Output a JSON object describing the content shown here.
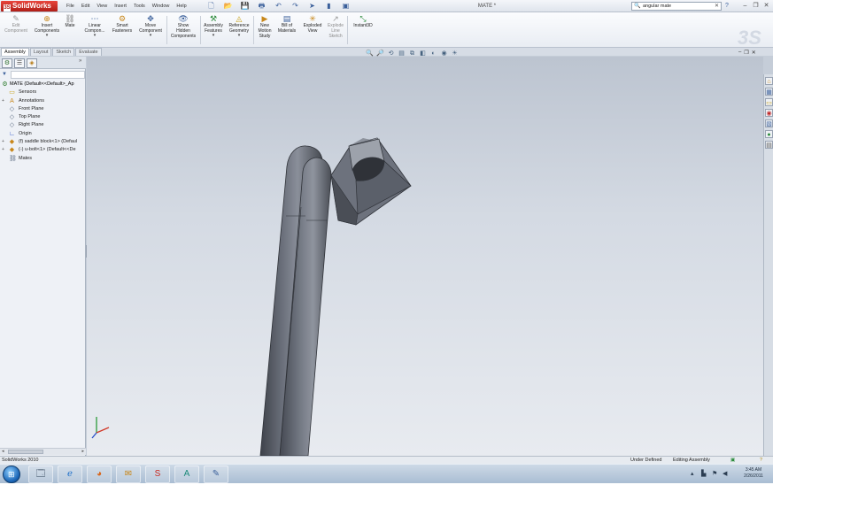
{
  "app": {
    "name": "SolidWorks",
    "document_title": "MATE *",
    "menus": [
      "File",
      "Edit",
      "View",
      "Insert",
      "Tools",
      "Window",
      "Help"
    ],
    "search": {
      "value": "angular mate"
    }
  },
  "quick_access": [
    {
      "icon": "new-document-icon",
      "glyph": "🗋"
    },
    {
      "icon": "open-folder-icon",
      "glyph": "📂"
    },
    {
      "icon": "save-icon",
      "glyph": "💾"
    },
    {
      "icon": "print-icon",
      "glyph": "🖶"
    },
    {
      "icon": "undo-icon",
      "glyph": "↶"
    },
    {
      "icon": "redo-icon",
      "glyph": "↷"
    },
    {
      "icon": "select-arrow-icon",
      "glyph": "➤"
    },
    {
      "icon": "rebuild-traffic-light-icon",
      "glyph": "▮"
    },
    {
      "icon": "options-icon",
      "glyph": "▣"
    }
  ],
  "command_manager": {
    "buttons": [
      {
        "label": "Edit\nComponent",
        "dim": true
      },
      {
        "label": "Insert\nComponents",
        "dropdown": true
      },
      {
        "label": "Mate"
      },
      {
        "label": "Linear\nCompon...",
        "dropdown": true
      },
      {
        "label": "Smart\nFasteners"
      },
      {
        "label": "Move\nComponent",
        "dropdown": true
      },
      {
        "label": "Show\nHidden\nComponents"
      },
      {
        "label": "Assembly\nFeatures",
        "dropdown": true
      },
      {
        "label": "Reference\nGeometry",
        "dropdown": true
      },
      {
        "label": "New\nMotion\nStudy"
      },
      {
        "label": "Bill of\nMaterials"
      },
      {
        "label": "Exploded\nView"
      },
      {
        "label": "Explode\nLine\nSketch",
        "dim": true
      },
      {
        "label": "Instant3D"
      }
    ],
    "tabs": [
      "Assembly",
      "Layout",
      "Sketch",
      "Evaluate"
    ],
    "active_tab": "Assembly"
  },
  "feature_tree": {
    "nodes": [
      {
        "label": "MATE  (Default<<Default>_Ap",
        "icon": "assembly-icon",
        "level": 0,
        "expander": ""
      },
      {
        "label": "Sensors",
        "icon": "sensor-folder-icon",
        "level": 1,
        "expander": ""
      },
      {
        "label": "Annotations",
        "icon": "annotations-icon",
        "level": 1,
        "expander": "+"
      },
      {
        "label": "Front Plane",
        "icon": "plane-icon",
        "level": 1,
        "expander": ""
      },
      {
        "label": "Top Plane",
        "icon": "plane-icon",
        "level": 1,
        "expander": ""
      },
      {
        "label": "Right Plane",
        "icon": "plane-icon",
        "level": 1,
        "expander": ""
      },
      {
        "label": "Origin",
        "icon": "origin-icon",
        "level": 1,
        "expander": ""
      },
      {
        "label": "(f) saddle block<1> (Defaul",
        "icon": "part-icon",
        "level": 1,
        "expander": "+"
      },
      {
        "label": "(-) u-bolt<1> (Default<<De",
        "icon": "part-icon",
        "level": 1,
        "expander": "+"
      },
      {
        "label": "Mates",
        "icon": "mates-folder-icon",
        "level": 1,
        "expander": ""
      }
    ]
  },
  "status_bar": {
    "left": "SolidWorks 2010",
    "state": "Under Defined",
    "mode": "Editing Assembly"
  },
  "taskbar": {
    "apps": [
      {
        "name": "file-manager-icon",
        "glyph": "🗔"
      },
      {
        "name": "internet-explorer-icon",
        "glyph": "ℯ"
      },
      {
        "name": "firefox-icon",
        "glyph": "◕"
      },
      {
        "name": "outlook-icon",
        "glyph": "✉"
      },
      {
        "name": "solidworks-taskbar-icon",
        "glyph": "S"
      },
      {
        "name": "autocad-icon",
        "glyph": "A"
      },
      {
        "name": "paint-icon",
        "glyph": "✎"
      }
    ],
    "clock_time": "3:45 AM",
    "clock_date": "2/26/2011"
  },
  "colors": {
    "accent": "#3a5f9a",
    "viewport_bg": "#d4dae3",
    "model_dark": "#50545e",
    "model_light": "#7b808c"
  }
}
